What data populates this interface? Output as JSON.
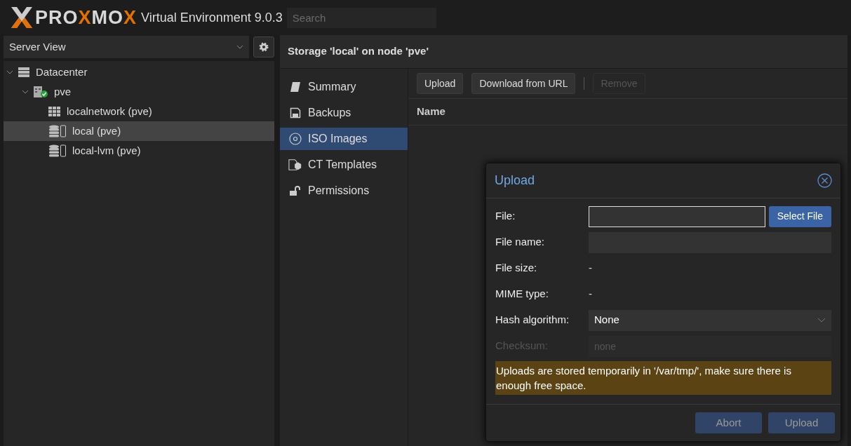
{
  "header": {
    "logo_parts": [
      {
        "text": "PRO",
        "color": "#d8d8d8"
      },
      {
        "text": "X",
        "color": "#e57000"
      },
      {
        "text": "MO",
        "color": "#d8d8d8"
      },
      {
        "text": "X",
        "color": "#e57000"
      }
    ],
    "product": "Virtual Environment 9.0.3",
    "search": {
      "placeholder": "Search"
    }
  },
  "sidebar": {
    "view": "Server View",
    "tree": [
      {
        "label": "Datacenter",
        "kind": "datacenter",
        "expanded": true,
        "selected": false,
        "children": [
          {
            "label": "pve",
            "kind": "node",
            "expanded": true,
            "selected": false,
            "children": [
              {
                "label": "localnetwork (pve)",
                "kind": "network",
                "selected": false
              },
              {
                "label": "local (pve)",
                "kind": "storage",
                "selected": true
              },
              {
                "label": "local-lvm (pve)",
                "kind": "storage",
                "selected": false
              }
            ]
          }
        ]
      }
    ]
  },
  "panel_title": "Storage 'local' on node 'pve'",
  "nav": [
    {
      "label": "Summary",
      "kind": "summary",
      "selected": false
    },
    {
      "label": "Backups",
      "kind": "backups",
      "selected": false
    },
    {
      "label": "ISO Images",
      "kind": "iso",
      "selected": true
    },
    {
      "label": "CT Templates",
      "kind": "templates",
      "selected": false
    },
    {
      "label": "Permissions",
      "kind": "permissions",
      "selected": false
    }
  ],
  "toolbar": [
    {
      "label": "Upload",
      "disabled": false
    },
    {
      "label": "Download from URL",
      "disabled": false
    },
    {
      "label": "Remove",
      "disabled": true
    }
  ],
  "table": {
    "columns": [
      "Name"
    ]
  },
  "dialog": {
    "title": "Upload",
    "fields": [
      {
        "label": "File:",
        "kind": "file",
        "button": "Select File",
        "disabled": false
      },
      {
        "label": "File name:",
        "kind": "input",
        "disabled": false
      },
      {
        "label": "File size:",
        "kind": "text",
        "value": "-",
        "disabled": false
      },
      {
        "label": "MIME type:",
        "kind": "text",
        "value": "-",
        "disabled": false
      },
      {
        "label": "Hash algorithm:",
        "kind": "select",
        "value": "None",
        "disabled": false
      },
      {
        "label": "Checksum:",
        "kind": "input",
        "placeholder": "none",
        "disabled": true
      }
    ],
    "warning": "Uploads are stored temporarily in '/var/tmp/', make sure there is enough free space.",
    "buttons": [
      {
        "label": "Abort",
        "disabled": true
      },
      {
        "label": "Upload",
        "disabled": true
      }
    ]
  }
}
